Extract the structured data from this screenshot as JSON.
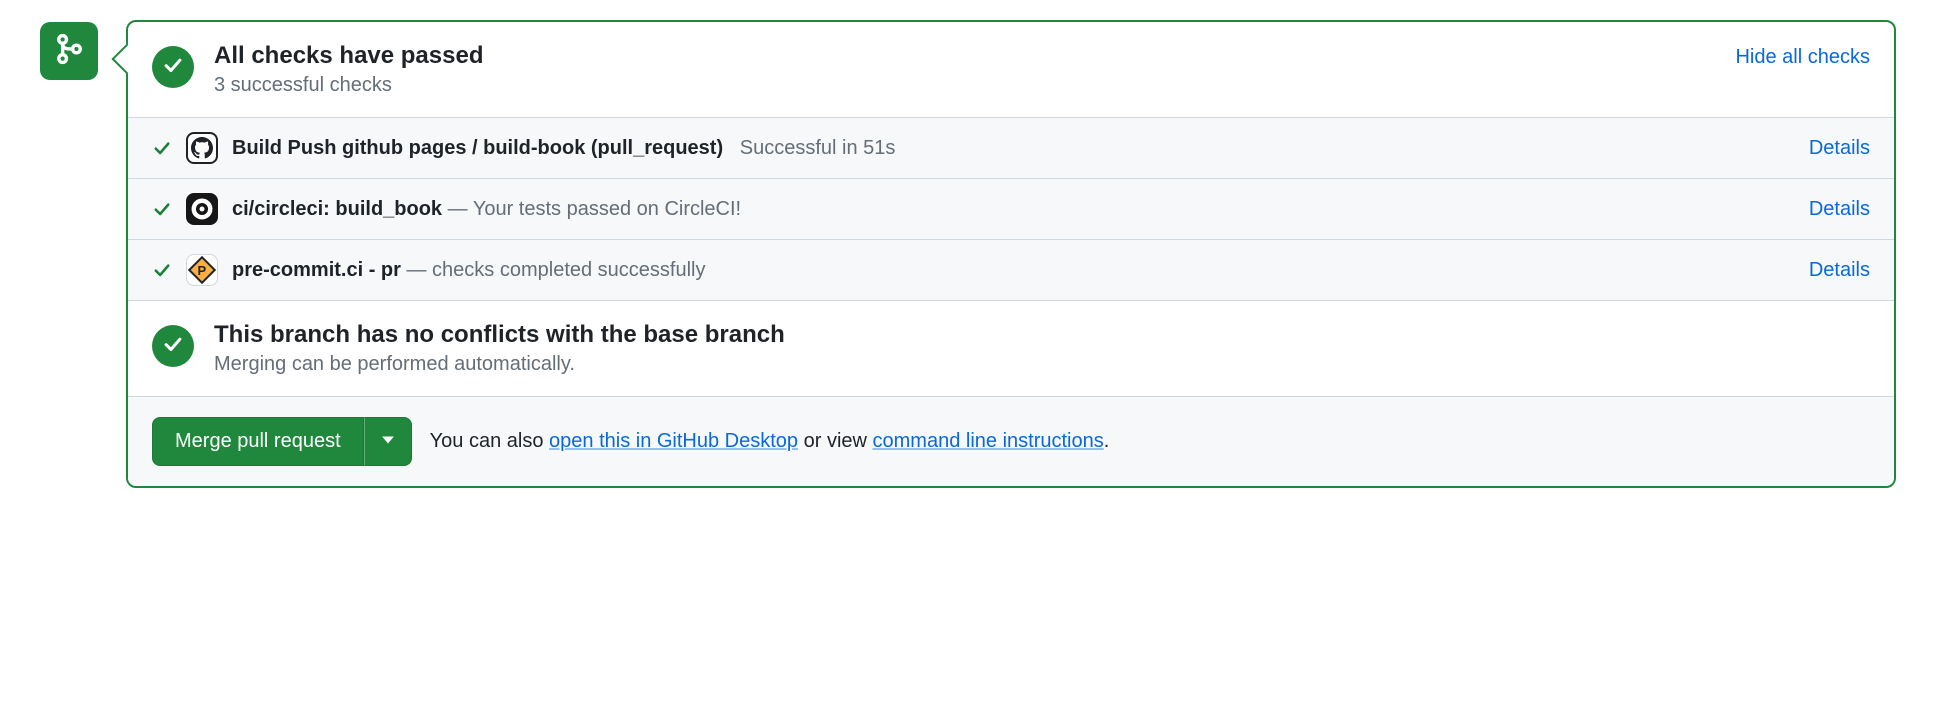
{
  "checks": {
    "title": "All checks have passed",
    "subtitle": "3 successful checks",
    "toggle_label": "Hide all checks",
    "items": [
      {
        "name": "Build Push github pages / build-book (pull_request)",
        "sep": "",
        "desc": "Successful in 51s",
        "details_label": "Details"
      },
      {
        "name": "ci/circleci: build_book",
        "sep": " — ",
        "desc": "Your tests passed on CircleCI!",
        "details_label": "Details"
      },
      {
        "name": "pre-commit.ci - pr",
        "sep": " — ",
        "desc": "checks completed successfully",
        "details_label": "Details"
      }
    ]
  },
  "conflicts": {
    "title": "This branch has no conflicts with the base branch",
    "subtitle": "Merging can be performed automatically."
  },
  "footer": {
    "merge_label": "Merge pull request",
    "text_prefix": "You can also ",
    "desktop_link": "open this in GitHub Desktop",
    "text_mid": " or view ",
    "cli_link": "command line instructions",
    "text_suffix": "."
  },
  "precommit_glyph": "P"
}
